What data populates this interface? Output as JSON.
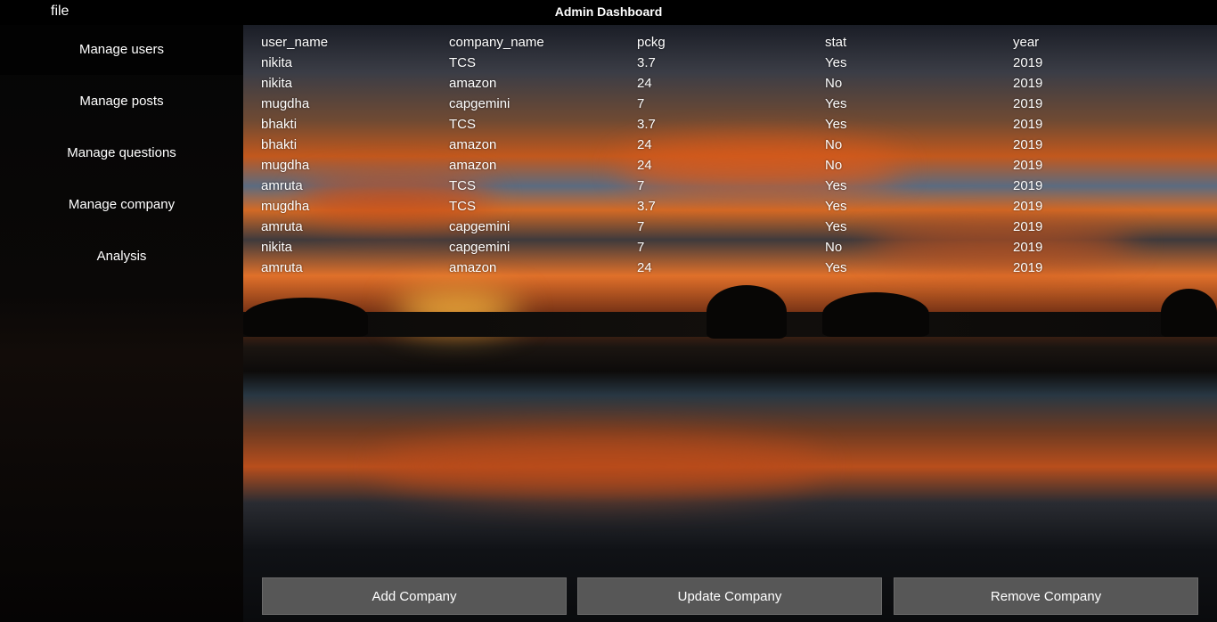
{
  "menu": {
    "file_label": "file"
  },
  "title": "Admin Dashboard",
  "sidebar": {
    "items": [
      {
        "label": "Manage users"
      },
      {
        "label": "Manage posts"
      },
      {
        "label": "Manage questions"
      },
      {
        "label": "Manage company"
      },
      {
        "label": "Analysis"
      }
    ]
  },
  "table": {
    "columns": [
      "user_name",
      "company_name",
      "pckg",
      "stat",
      "year"
    ],
    "rows": [
      [
        "nikita",
        "TCS",
        "3.7",
        "Yes",
        "2019"
      ],
      [
        "nikita",
        "amazon",
        "24",
        "No",
        "2019"
      ],
      [
        "mugdha",
        "capgemini",
        "7",
        "Yes",
        "2019"
      ],
      [
        "bhakti",
        "TCS",
        "3.7",
        "Yes",
        "2019"
      ],
      [
        "bhakti",
        "amazon",
        "24",
        "No",
        "2019"
      ],
      [
        "mugdha",
        "amazon",
        "24",
        "No",
        "2019"
      ],
      [
        "amruta",
        "TCS",
        "7",
        "Yes",
        "2019"
      ],
      [
        "mugdha",
        "TCS",
        "3.7",
        "Yes",
        "2019"
      ],
      [
        "amruta",
        "capgemini",
        "7",
        "Yes",
        "2019"
      ],
      [
        "nikita",
        "capgemini",
        "7",
        "No",
        "2019"
      ],
      [
        "amruta",
        "amazon",
        "24",
        "Yes",
        "2019"
      ]
    ]
  },
  "buttons": {
    "add": "Add Company",
    "update": "Update Company",
    "remove": "Remove Company"
  },
  "colors": {
    "button_bg": "#575757",
    "sidebar_bg": "#050505",
    "accent_sky": "#e0702a"
  }
}
